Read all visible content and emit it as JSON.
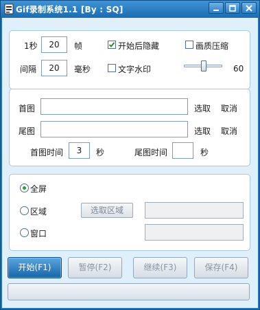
{
  "window": {
    "title": "Gif录制系统1.1  [By : SQ]",
    "accent": "#1f73b8",
    "client_bg": "#dff0fb",
    "buttons": [
      "minimize-icon",
      "maximize-icon",
      "close-icon"
    ]
  },
  "frame_group": {
    "fps_prefix": "1秒",
    "fps_value": "20",
    "fps_unit": "帧",
    "interval_label": "间隔",
    "interval_value": "20",
    "interval_unit": "毫秒",
    "hide_on_start": {
      "label": "开始后隐藏",
      "checked": true
    },
    "compress": {
      "label": "画质压缩",
      "checked": false
    },
    "watermark": {
      "label": "文字水印",
      "checked": false
    },
    "quality": {
      "value": "60",
      "fraction": 0.6
    }
  },
  "image_group": {
    "first_label": "首图",
    "first_value": "",
    "first_select": "选取",
    "first_cancel": "取消",
    "last_label": "尾图",
    "last_value": "",
    "last_select": "选取",
    "last_cancel": "取消",
    "first_time_label": "首图时间",
    "first_time_value": "3",
    "first_time_unit": "秒",
    "last_time_label": "尾图时间",
    "last_time_value": "",
    "last_time_unit": "秒"
  },
  "capture_group": {
    "selected": "fullscreen",
    "fullscreen_label": "全屏",
    "region_label": "区域",
    "window_label": "窗口",
    "select_region_button": "选取区域",
    "region_value": "",
    "window_value": ""
  },
  "actions": {
    "start": "开始(F1)",
    "pause": "暂停(F2)",
    "continue": "继续(F3)",
    "save": "保存(F4)"
  },
  "progress": {
    "fraction": 0
  }
}
